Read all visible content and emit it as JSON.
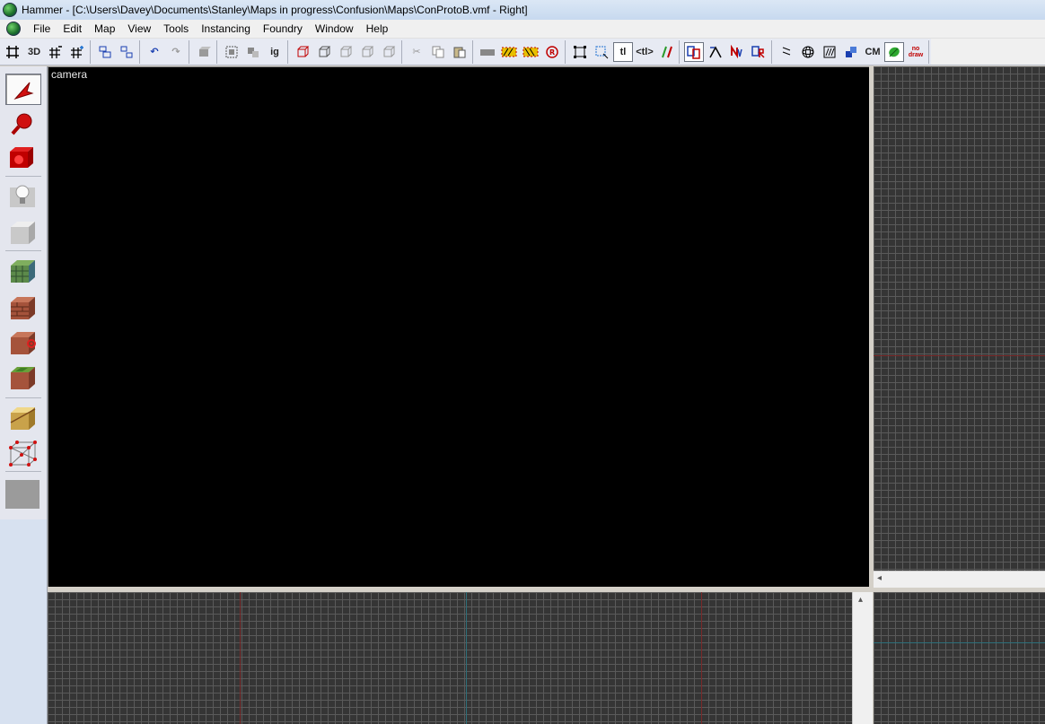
{
  "window": {
    "title": "Hammer - [C:\\Users\\Davey\\Documents\\Stanley\\Maps in progress\\Confusion\\Maps\\ConProtoB.vmf - Right]"
  },
  "menu": {
    "items": [
      "File",
      "Edit",
      "Map",
      "View",
      "Tools",
      "Instancing",
      "Foundry",
      "Window",
      "Help"
    ]
  },
  "toolbar": {
    "grid_3d_label": "3D",
    "ig_label": "ig",
    "tl_label": "tl",
    "tlt_label": "<tl>",
    "cm_label": "CM",
    "nodraw_label": "no draw"
  },
  "views": {
    "camera_label": "camera"
  },
  "tools": [
    {
      "name": "selection",
      "icon": "arrow-pointer-icon",
      "color": "#d01010"
    },
    {
      "name": "magnify",
      "icon": "magnify-icon",
      "color": "#d01010"
    },
    {
      "name": "camera",
      "icon": "camera-icon",
      "color": "#c00000"
    },
    {
      "name": "entity",
      "icon": "lightbulb-icon",
      "color": "#cfcfcf"
    },
    {
      "name": "block",
      "icon": "block-icon",
      "color": "#cfcfcf"
    },
    {
      "name": "texture-application",
      "icon": "texture-cube-icon",
      "color": "#5c8a4a"
    },
    {
      "name": "apply-current-texture",
      "icon": "brick-cube-icon",
      "color": "#a5533b"
    },
    {
      "name": "decal",
      "icon": "decal-cube-icon",
      "color": "#b0442f"
    },
    {
      "name": "overlay",
      "icon": "overlay-cube-icon",
      "color": "#7a6a2a"
    },
    {
      "name": "clipping",
      "icon": "clip-cube-icon",
      "color": "#c9a24a"
    },
    {
      "name": "vertex",
      "icon": "vertex-cube-icon",
      "color": "#c03030"
    },
    {
      "name": "path",
      "icon": "path-tool-icon",
      "color": "#9b9b9b"
    }
  ]
}
